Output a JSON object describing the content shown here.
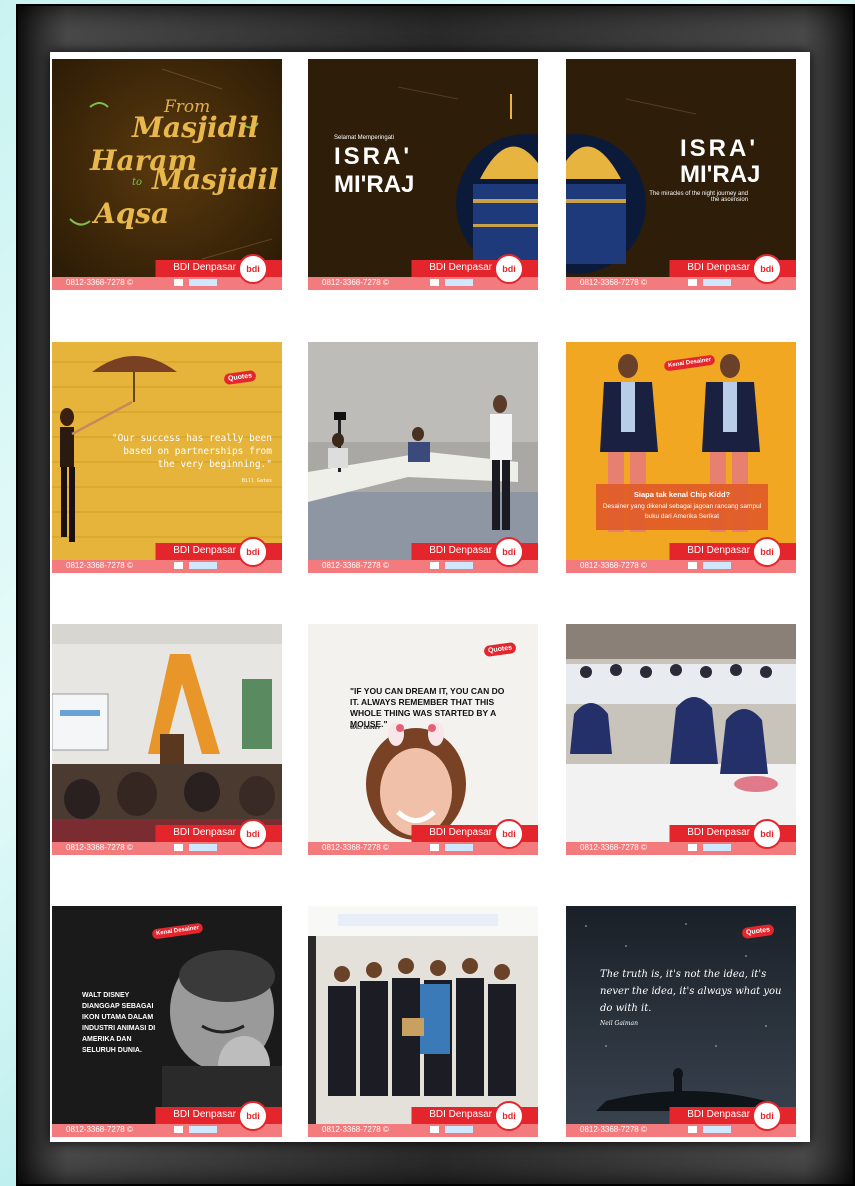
{
  "footer": {
    "brand": "BDI Denpasar",
    "phone": "0812-3368-7278 ©",
    "logo": "bdi"
  },
  "tiles": [
    {
      "id": "t1",
      "lines": [
        "From",
        "Masjidil",
        "Haram",
        "to",
        "Masjidil",
        "Aqsa"
      ]
    },
    {
      "id": "t2",
      "pre": "Selamat Memperingati",
      "title1": "ISRA'",
      "title2": "MI'RAJ"
    },
    {
      "id": "t3",
      "title1": "ISRA'",
      "title2": "MI'RAJ",
      "sub": "The miracles of the night journey and the ascension"
    },
    {
      "id": "t4",
      "badge": "Quotes",
      "quote": "\"Our success has really been based on partnerships from the very beginning.\"",
      "author": "Bill Gates"
    },
    {
      "id": "t5"
    },
    {
      "id": "t6",
      "badge": "Kenal Desainer",
      "heading": "Siapa tak kenal Chip Kidd?",
      "body": "Desainer yang dikenal sebagai jagoan rancang sampul buku dari Amerika Serikat"
    },
    {
      "id": "t7"
    },
    {
      "id": "t8",
      "badge": "Quotes",
      "quote": "\"IF YOU CAN DREAM IT, YOU CAN DO IT. ALWAYS REMEMBER THAT THIS WHOLE THING WAS STARTED BY A MOUSE.\"",
      "author": "WALT DISNEY"
    },
    {
      "id": "t9"
    },
    {
      "id": "t10",
      "badge": "Kenal Desainer",
      "body": "WALT DISNEY DIANGGAP SEBAGAI IKON UTAMA DALAM INDUSTRI ANIMASI DI AMERIKA DAN SELURUH DUNIA."
    },
    {
      "id": "t11"
    },
    {
      "id": "t12",
      "badge": "Quotes",
      "quote": "The truth is, it's not the idea, it's never the idea, it's always what you do with it.",
      "author": "Neil Gaiman"
    }
  ]
}
